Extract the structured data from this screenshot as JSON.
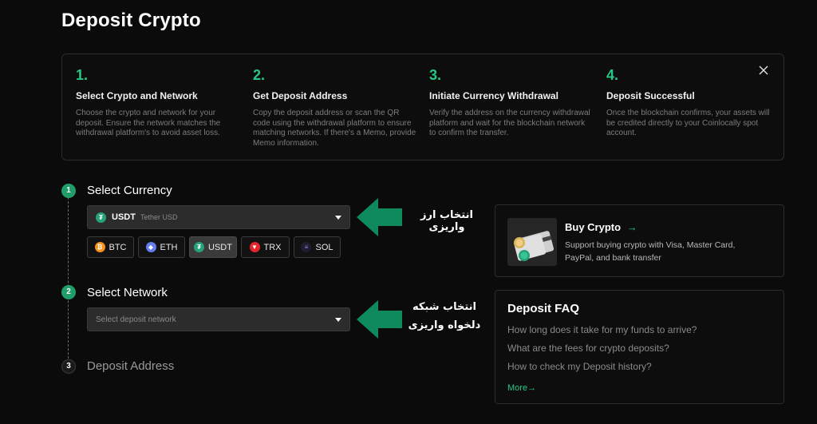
{
  "page": {
    "title": "Deposit Crypto"
  },
  "steps": [
    {
      "num": "1.",
      "title": "Select Crypto and Network",
      "desc": "Choose the crypto and network for your deposit. Ensure the network matches the withdrawal platform's to avoid asset loss."
    },
    {
      "num": "2.",
      "title": "Get Deposit Address",
      "desc": "Copy the deposit address or scan the QR code using the withdrawal platform to ensure matching networks. If there's a Memo, provide Memo information."
    },
    {
      "num": "3.",
      "title": "Initiate Currency Withdrawal",
      "desc": "Verify the address on the currency withdrawal platform and wait for the blockchain network to confirm the transfer."
    },
    {
      "num": "4.",
      "title": "Deposit Successful",
      "desc": "Once the blockchain confirms, your assets will be credited directly to your Coinlocally spot account."
    }
  ],
  "timeline": {
    "step1": {
      "num": "1",
      "title": "Select Currency"
    },
    "step2": {
      "num": "2",
      "title": "Select Network"
    },
    "step3": {
      "num": "3",
      "title": "Deposit Address"
    }
  },
  "currency_select": {
    "symbol": "USDT",
    "name": "Tether USD",
    "icon": "usdt-icon"
  },
  "chips": [
    {
      "label": "BTC",
      "icon": "btc-icon",
      "selected": false
    },
    {
      "label": "ETH",
      "icon": "eth-icon",
      "selected": false
    },
    {
      "label": "USDT",
      "icon": "usdt-icon",
      "selected": true
    },
    {
      "label": "TRX",
      "icon": "trx-icon",
      "selected": false
    },
    {
      "label": "SOL",
      "icon": "sol-icon",
      "selected": false
    }
  ],
  "network_select": {
    "placeholder": "Select deposit network"
  },
  "annotations": {
    "currency": "انتخاب ارز واریزی",
    "network_line1": "انتخاب شبکه",
    "network_line2": "دلخواه واریزی"
  },
  "buy_crypto": {
    "title": "Buy Crypto",
    "arrow": "→",
    "desc": "Support buying crypto with Visa, Master Card, PayPal, and bank transfer"
  },
  "faq": {
    "title": "Deposit FAQ",
    "items": [
      "How long does it take for my funds to arrive?",
      "What are the fees for crypto deposits?",
      "How to check my Deposit history?"
    ],
    "more": "More→"
  },
  "colors": {
    "accent": "#29c785",
    "arrow_green": "#0e8a5c",
    "background": "#0b0b0b"
  }
}
